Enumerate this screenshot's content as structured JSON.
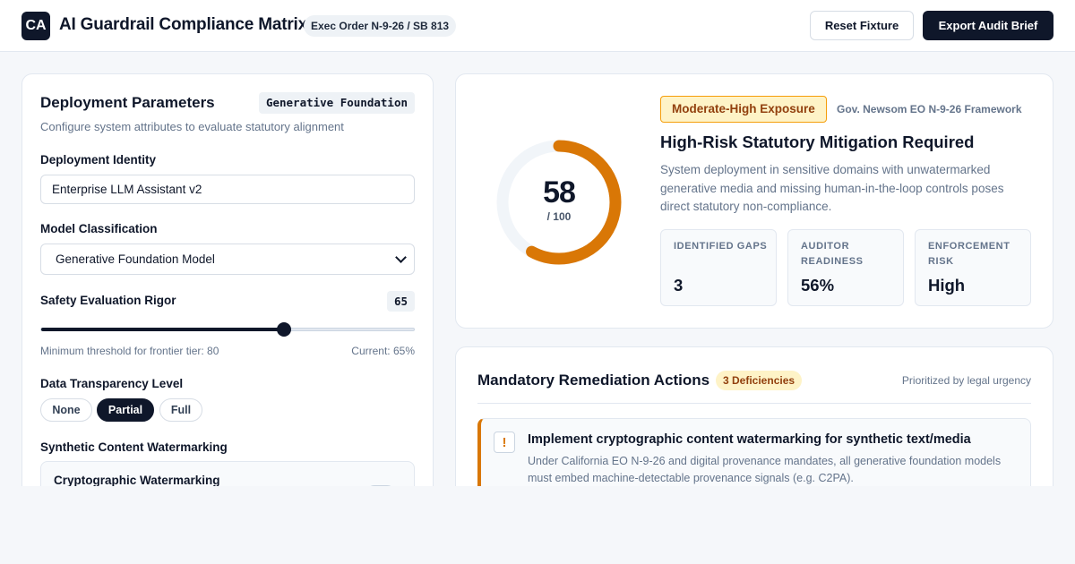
{
  "header": {
    "logo_text": "CA",
    "title": "AI Guardrail Compliance Matrix",
    "exec_badge": "Exec Order N-9-26 / SB 813",
    "reset_label": "Reset Fixture",
    "export_label": "Export Audit Brief"
  },
  "params": {
    "title": "Deployment Parameters",
    "tag": "Generative Foundation",
    "subtitle": "Configure system attributes to evaluate statutory alignment",
    "identity_label": "Deployment Identity",
    "identity_value": "Enterprise LLM Assistant v2",
    "classification_label": "Model Classification",
    "classification_value": "Generative Foundation Model",
    "rigor_label": "Safety Evaluation Rigor",
    "rigor_value": "65",
    "rigor_level": 0.65,
    "rigor_min_text": "Minimum threshold for frontier tier: 80",
    "rigor_current_text": "Current: 65%",
    "transparency_label": "Data Transparency Level",
    "transparency_options": [
      "None",
      "Partial",
      "Full"
    ],
    "transparency_selected": "Partial",
    "watermark_label": "Synthetic Content Watermarking",
    "watermark_option_title": "Cryptographic Watermarking"
  },
  "score": {
    "value": "58",
    "max": "/ 100",
    "level": 0.58,
    "exposure": "Moderate-High Exposure",
    "framework": "Gov. Newsom EO N-9-26 Framework",
    "heading": "High-Risk Statutory Mitigation Required",
    "description": "System deployment in sensitive domains with unwatermarked generative media and missing human-in-the-loop controls poses direct statutory non-compliance.",
    "metrics": [
      {
        "label": "Identified Gaps",
        "value": "3"
      },
      {
        "label": "Auditor Readiness",
        "value": "56%"
      },
      {
        "label": "Enforcement Risk",
        "value": "High"
      }
    ],
    "colors": {
      "arc": "#d97706",
      "track": "#f1f5f9"
    }
  },
  "remediation": {
    "title": "Mandatory Remediation Actions",
    "badge": "3 Deficiencies",
    "priority": "Prioritized by legal urgency",
    "items": [
      {
        "icon": "!",
        "title": "Implement cryptographic content watermarking for synthetic text/media",
        "description": "Under California EO N-9-26 and digital provenance mandates, all generative foundation models must embed machine-detectable provenance signals (e.g. C2PA)."
      }
    ]
  }
}
